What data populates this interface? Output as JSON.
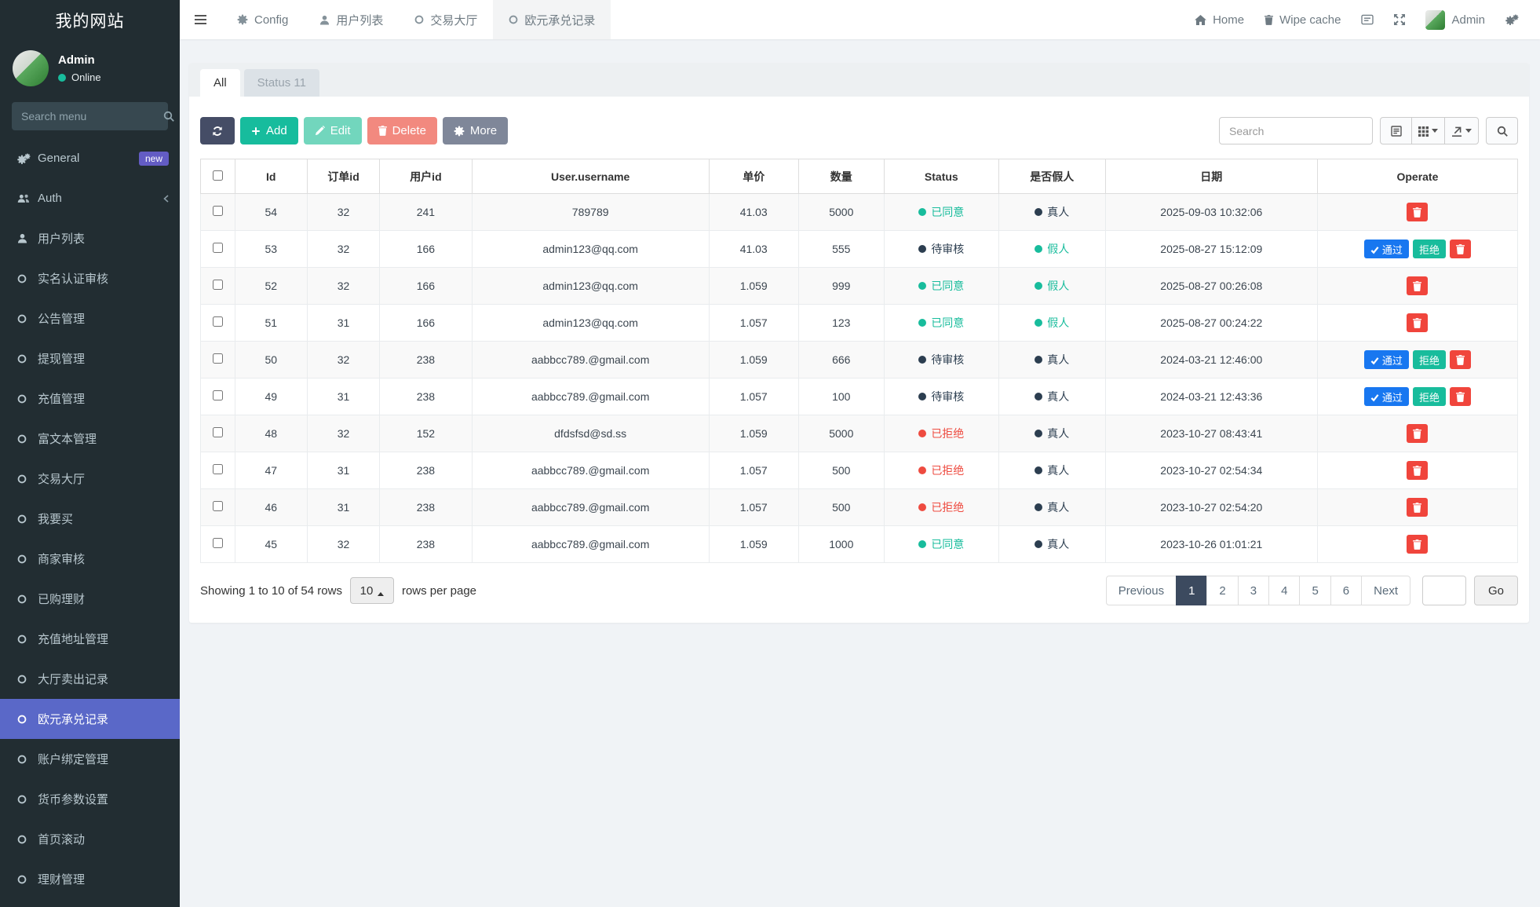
{
  "sidebar": {
    "title": "我的网站",
    "user": {
      "name": "Admin",
      "status": "Online"
    },
    "search_placeholder": "Search menu",
    "items": [
      {
        "key": "general",
        "label": "General",
        "icon": "gears",
        "badge": "new"
      },
      {
        "key": "auth",
        "label": "Auth",
        "icon": "users",
        "chevron": true
      },
      {
        "key": "user-list",
        "label": "用户列表",
        "icon": "user"
      },
      {
        "key": "realname-audit",
        "label": "实名认证审核",
        "icon": "circle"
      },
      {
        "key": "notice",
        "label": "公告管理",
        "icon": "circle"
      },
      {
        "key": "withdraw",
        "label": "提现管理",
        "icon": "circle"
      },
      {
        "key": "recharge",
        "label": "充值管理",
        "icon": "circle"
      },
      {
        "key": "richtext",
        "label": "富文本管理",
        "icon": "circle"
      },
      {
        "key": "trade-hall",
        "label": "交易大厅",
        "icon": "circle"
      },
      {
        "key": "want-buy",
        "label": "我要买",
        "icon": "circle"
      },
      {
        "key": "merchant-audit",
        "label": "商家审核",
        "icon": "circle"
      },
      {
        "key": "purchased",
        "label": "已购理财",
        "icon": "circle"
      },
      {
        "key": "recharge-address",
        "label": "充值地址管理",
        "icon": "circle"
      },
      {
        "key": "hall-sell-record",
        "label": "大厅卖出记录",
        "icon": "circle"
      },
      {
        "key": "euro-exchange",
        "label": "欧元承兑记录",
        "icon": "circle",
        "active": true
      },
      {
        "key": "account-binding",
        "label": "账户绑定管理",
        "icon": "circle"
      },
      {
        "key": "currency-params",
        "label": "货币参数设置",
        "icon": "circle"
      },
      {
        "key": "home-scroll",
        "label": "首页滚动",
        "icon": "circle"
      },
      {
        "key": "finance",
        "label": "理财管理",
        "icon": "circle"
      }
    ]
  },
  "topnav": {
    "tabs": [
      {
        "key": "config",
        "label": "Config",
        "icon": "gear"
      },
      {
        "key": "user-list",
        "label": "用户列表",
        "icon": "user"
      },
      {
        "key": "trade-hall",
        "label": "交易大厅",
        "icon": "circle"
      },
      {
        "key": "euro-exchange",
        "label": "欧元承兑记录",
        "icon": "circle",
        "active": true
      }
    ],
    "right": {
      "home": "Home",
      "wipe_cache": "Wipe cache",
      "admin": "Admin"
    }
  },
  "panel": {
    "tabs": [
      {
        "label": "All",
        "active": true
      },
      {
        "label": "Status 11",
        "active": false
      }
    ]
  },
  "toolbar": {
    "add_label": "Add",
    "edit_label": "Edit",
    "delete_label": "Delete",
    "more_label": "More",
    "search_placeholder": "Search"
  },
  "table": {
    "columns": [
      "Id",
      "订单id",
      "用户id",
      "User.username",
      "单价",
      "数量",
      "Status",
      "是否假人",
      "日期",
      "Operate"
    ],
    "action_labels": {
      "approve": "通过",
      "reject": "拒绝"
    },
    "rows": [
      {
        "id": "54",
        "order_id": "32",
        "user_id": "241",
        "username": "789789",
        "price": "41.03",
        "qty": "5000",
        "status": "已同意",
        "status_type": "agreed",
        "fake": "真人",
        "fake_type": "real",
        "date": "2025-09-03 10:32:06",
        "actions": [
          "delete"
        ]
      },
      {
        "id": "53",
        "order_id": "32",
        "user_id": "166",
        "username": "admin123@qq.com",
        "price": "41.03",
        "qty": "555",
        "status": "待审核",
        "status_type": "pending",
        "fake": "假人",
        "fake_type": "fake",
        "date": "2025-08-27 15:12:09",
        "actions": [
          "approve",
          "reject",
          "delete"
        ]
      },
      {
        "id": "52",
        "order_id": "32",
        "user_id": "166",
        "username": "admin123@qq.com",
        "price": "1.059",
        "qty": "999",
        "status": "已同意",
        "status_type": "agreed",
        "fake": "假人",
        "fake_type": "fake",
        "date": "2025-08-27 00:26:08",
        "actions": [
          "delete"
        ]
      },
      {
        "id": "51",
        "order_id": "31",
        "user_id": "166",
        "username": "admin123@qq.com",
        "price": "1.057",
        "qty": "123",
        "status": "已同意",
        "status_type": "agreed",
        "fake": "假人",
        "fake_type": "fake",
        "date": "2025-08-27 00:24:22",
        "actions": [
          "delete"
        ]
      },
      {
        "id": "50",
        "order_id": "32",
        "user_id": "238",
        "username": "aabbcc789.@gmail.com",
        "price": "1.059",
        "qty": "666",
        "status": "待审核",
        "status_type": "pending",
        "fake": "真人",
        "fake_type": "real",
        "date": "2024-03-21 12:46:00",
        "actions": [
          "approve",
          "reject",
          "delete"
        ]
      },
      {
        "id": "49",
        "order_id": "31",
        "user_id": "238",
        "username": "aabbcc789.@gmail.com",
        "price": "1.057",
        "qty": "100",
        "status": "待审核",
        "status_type": "pending",
        "fake": "真人",
        "fake_type": "real",
        "date": "2024-03-21 12:43:36",
        "actions": [
          "approve",
          "reject",
          "delete"
        ]
      },
      {
        "id": "48",
        "order_id": "32",
        "user_id": "152",
        "username": "dfdsfsd@sd.ss",
        "price": "1.059",
        "qty": "5000",
        "status": "已拒绝",
        "status_type": "rejected",
        "fake": "真人",
        "fake_type": "real",
        "date": "2023-10-27 08:43:41",
        "actions": [
          "delete"
        ]
      },
      {
        "id": "47",
        "order_id": "31",
        "user_id": "238",
        "username": "aabbcc789.@gmail.com",
        "price": "1.057",
        "qty": "500",
        "status": "已拒绝",
        "status_type": "rejected",
        "fake": "真人",
        "fake_type": "real",
        "date": "2023-10-27 02:54:34",
        "actions": [
          "delete"
        ]
      },
      {
        "id": "46",
        "order_id": "31",
        "user_id": "238",
        "username": "aabbcc789.@gmail.com",
        "price": "1.057",
        "qty": "500",
        "status": "已拒绝",
        "status_type": "rejected",
        "fake": "真人",
        "fake_type": "real",
        "date": "2023-10-27 02:54:20",
        "actions": [
          "delete"
        ]
      },
      {
        "id": "45",
        "order_id": "32",
        "user_id": "238",
        "username": "aabbcc789.@gmail.com",
        "price": "1.059",
        "qty": "1000",
        "status": "已同意",
        "status_type": "agreed",
        "fake": "真人",
        "fake_type": "real",
        "date": "2023-10-26 01:01:21",
        "actions": [
          "delete"
        ]
      }
    ]
  },
  "footer": {
    "showing": "Showing 1 to 10 of 54 rows",
    "page_size": "10",
    "rows_per_page": "rows per page",
    "pages": [
      "Previous",
      "1",
      "2",
      "3",
      "4",
      "5",
      "6",
      "Next"
    ],
    "active_page": "1",
    "go_label": "Go"
  },
  "colors": {
    "sidebar_bg": "#222d32",
    "sidebar_text": "#b8c7ce",
    "active_menu_bg": "#5a68c8",
    "badge_new_bg": "#635cc4",
    "accent_green": "#18bc9c",
    "dark_navy": "#2c3e50",
    "status_red": "#ee4b40",
    "approve_blue": "#1877f0",
    "trash_red": "#f0453c",
    "pagination_active_bg": "#3c4a5f",
    "panel_heading_bg": "#edf0f2",
    "content_bg": "#f0f3f6"
  }
}
